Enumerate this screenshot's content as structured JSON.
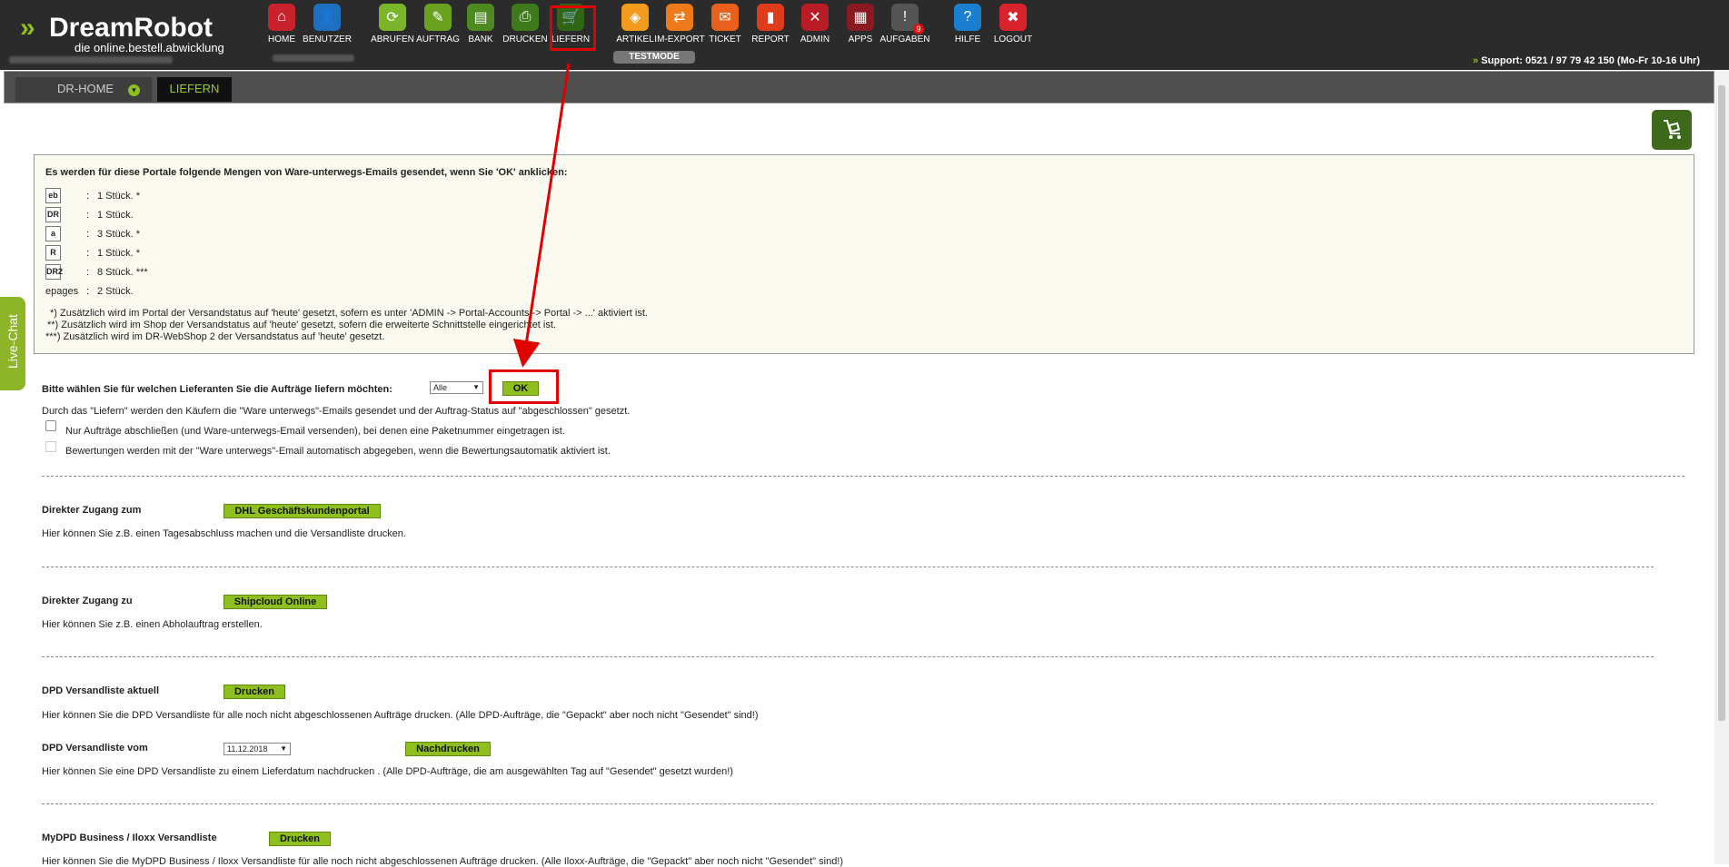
{
  "app": {
    "brand": "DreamRobot",
    "tagline": "die online.bestell.abwicklung",
    "testmode": "TESTMODE",
    "support": "Support: 0521 / 97 79 42 150 (Mo-Fr 10-16 Uhr)"
  },
  "nav": [
    {
      "label": "HOME",
      "icon": "home-icon",
      "color": "#c8232c"
    },
    {
      "label": "BENUTZER",
      "icon": "user-icon",
      "color": "#1f6fc0"
    },
    {
      "label": "ABRUFEN",
      "icon": "download-icon",
      "color": "#7ab52a"
    },
    {
      "label": "AUFTRAG",
      "icon": "order-icon",
      "color": "#6aa21f"
    },
    {
      "label": "BANK",
      "icon": "bank-icon",
      "color": "#4d8a1f"
    },
    {
      "label": "DRUCKEN",
      "icon": "printer-icon",
      "color": "#3e7a1c"
    },
    {
      "label": "LIEFERN",
      "icon": "cart-icon",
      "color": "#2f6515"
    },
    {
      "label": "ARTIKEL",
      "icon": "box-icon",
      "color": "#f29b1c"
    },
    {
      "label": "IM-EXPORT",
      "icon": "transfer-icon",
      "color": "#ee7a1b"
    },
    {
      "label": "TICKET",
      "icon": "mail-icon",
      "color": "#e8601b"
    },
    {
      "label": "REPORT",
      "icon": "chart-icon",
      "color": "#de3c1b"
    },
    {
      "label": "ADMIN",
      "icon": "tools-icon",
      "color": "#b81c24"
    },
    {
      "label": "APPS",
      "icon": "grid-icon",
      "color": "#8a1a1f"
    },
    {
      "label": "AUFGABEN",
      "icon": "tasks-icon",
      "color": "#555555",
      "badge": "9"
    },
    {
      "label": "HILFE",
      "icon": "help-icon",
      "color": "#1a7fd1"
    },
    {
      "label": "LOGOUT",
      "icon": "logout-icon",
      "color": "#d9232c"
    }
  ],
  "tabs": {
    "home": "DR-HOME",
    "liefern": "LIEFERN"
  },
  "info": {
    "heading": "Es werden für diese Portale folgende Mengen von Ware-unterwegs-Emails gesendet, wenn Sie 'OK' anklicken:",
    "portals": [
      {
        "icon": "ebay-icon",
        "abbr": "eb",
        "value": "1 Stück. *"
      },
      {
        "icon": "dreamrobot-icon",
        "abbr": "DR",
        "value": "1 Stück."
      },
      {
        "icon": "amazon-icon",
        "abbr": "a",
        "value": "3 Stück. *"
      },
      {
        "icon": "rakuten-icon",
        "abbr": "R",
        "value": "1 Stück. *"
      },
      {
        "icon": "dr2-icon",
        "abbr": "DR2",
        "value": "8 Stück. ***"
      },
      {
        "name": "epages",
        "value": "2 Stück."
      }
    ],
    "notes": [
      "*) Zusätzlich wird im Portal der Versandstatus auf 'heute' gesetzt, sofern es unter 'ADMIN -> Portal-Accounts -> Portal -> ...' aktiviert ist.",
      "**) Zusätzlich wird im Shop der Versandstatus auf 'heute' gesetzt, sofern die erweiterte Schnittstelle eingerichtet ist.",
      "***) Zusätzlich wird im DR-WebShop 2 der Versandstatus auf 'heute' gesetzt."
    ]
  },
  "supplier": {
    "label": "Bitte wählen Sie für welchen Lieferanten Sie die Aufträge liefern möchten:",
    "select": "Alle",
    "ok": "OK",
    "desc": "Durch das \"Liefern\" werden den Käufern die \"Ware unterwegs\"-Emails gesendet und der Auftrag-Status auf \"abgeschlossen\" gesetzt.",
    "cb1": "Nur Aufträge abschließen (und Ware-unterwegs-Email versenden), bei denen eine Paketnummer eingetragen ist.",
    "cb2": "Bewertungen werden mit der \"Ware unterwegs\"-Email automatisch abgegeben, wenn die Bewertungsautomatik aktiviert ist."
  },
  "dhl": {
    "label": "Direkter Zugang zum",
    "button": "DHL Geschäftskundenportal",
    "desc": "Hier können Sie z.B. einen Tagesabschluss machen und die Versandliste drucken."
  },
  "shipcloud": {
    "label": "Direkter Zugang zu",
    "button": "Shipcloud Online",
    "desc": "Hier können Sie z.B. einen Abholauftrag erstellen."
  },
  "dpd": {
    "label": "DPD Versandliste aktuell",
    "button": "Drucken",
    "desc": "Hier können Sie die DPD Versandliste für alle noch nicht abgeschlossenen Aufträge drucken. (Alle DPD-Aufträge, die \"Gepackt\" aber noch nicht \"Gesendet\" sind!)",
    "label2": "DPD Versandliste vom",
    "date": "11.12.2018",
    "button2": "Nachdrucken",
    "desc2": "Hier können Sie eine DPD Versandliste zu einem Lieferdatum nachdrucken . (Alle DPD-Aufträge, die am ausgewählten Tag auf \"Gesendet\" gesetzt wurden!)"
  },
  "mydpd": {
    "label": "MyDPD Business / Iloxx Versandliste",
    "button": "Drucken",
    "desc": "Hier können Sie die MyDPD Business / Iloxx Versandliste für alle noch nicht abgeschlossenen Aufträge drucken. (Alle Iloxx-Aufträge, die \"Gepackt\" aber noch nicht \"Gesendet\" sind!)"
  },
  "livechat": "Live-Chat"
}
